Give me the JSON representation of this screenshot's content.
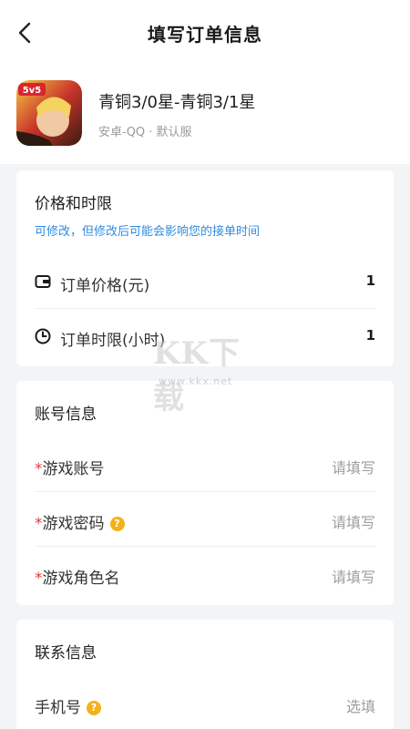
{
  "nav": {
    "title": "填写订单信息",
    "back_icon": "chevron-left-icon"
  },
  "game": {
    "name": "青铜3/0星-青铜3/1星",
    "sub": "安卓-QQ · 默认服",
    "icon_badge": "5v5"
  },
  "price_section": {
    "title": "价格和时限",
    "hint": "可修改，但修改后可能会影响您的接单时间",
    "rows": [
      {
        "icon": "wallet-icon",
        "label": "订单价格(元)",
        "value": "1"
      },
      {
        "icon": "clock-icon",
        "label": "订单时限(小时)",
        "value": "1"
      }
    ]
  },
  "account_section": {
    "title": "账号信息",
    "required_mark": "*",
    "rows": [
      {
        "label": "游戏账号",
        "placeholder": "请填写"
      },
      {
        "label": "游戏密码",
        "placeholder": "请填写",
        "help": "?"
      },
      {
        "label": "游戏角色名",
        "placeholder": "请填写"
      }
    ]
  },
  "contact_section": {
    "title": "联系信息",
    "rows": [
      {
        "label": "手机号",
        "placeholder": "选填",
        "help": "?"
      }
    ]
  },
  "watermark": {
    "big": "KK下载",
    "small": "www.kkx.net"
  },
  "colors": {
    "accent_blue": "#2f8be0",
    "required_red": "#e53935",
    "help_yellow": "#f3b21b"
  }
}
